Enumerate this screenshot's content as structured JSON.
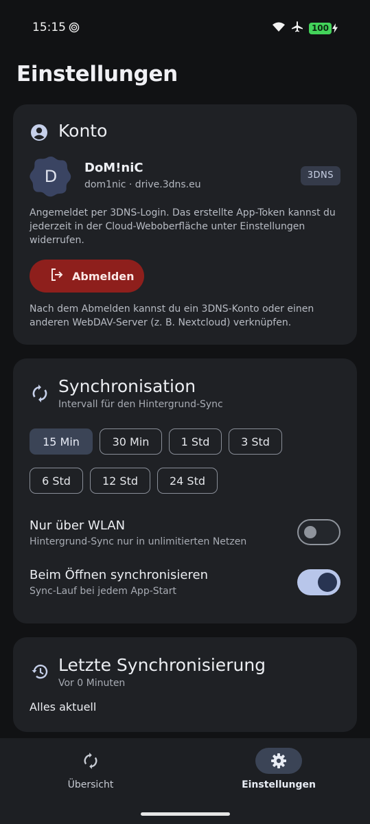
{
  "status_bar": {
    "time": "15:15",
    "battery": "100"
  },
  "page_title": "Einstellungen",
  "konto": {
    "title": "Konto",
    "avatar_letter": "D",
    "user_name": "DoM!niC",
    "user_sub": "dom1nic · drive.3dns.eu",
    "badge": "3DNS",
    "info": "Angemeldet per 3DNS-Login. Das erstellte App-Token kannst du jederzeit in der Cloud-Weboberfläche unter Einstellungen widerrufen.",
    "logout_label": "Abmelden",
    "note": "Nach dem Abmelden kannst du ein 3DNS-Konto oder einen anderen WebDAV-Server (z. B. Nextcloud) verknüpfen."
  },
  "sync": {
    "title": "Synchronisation",
    "subtitle": "Intervall für den Hintergrund-Sync",
    "intervals": [
      "15 Min",
      "30 Min",
      "1 Std",
      "3 Std",
      "6 Std",
      "12 Std",
      "24 Std"
    ],
    "selected_interval": "15 Min",
    "wlan_title": "Nur über WLAN",
    "wlan_sub": "Hintergrund-Sync nur in unlimitierten Netzen",
    "wlan_enabled": false,
    "open_title": "Beim Öffnen synchronisieren",
    "open_sub": "Sync-Lauf bei jedem App-Start",
    "open_enabled": true
  },
  "last_sync": {
    "title": "Letzte Synchronisierung",
    "subtitle": "Vor 0 Minuten",
    "status": "Alles aktuell"
  },
  "nav": {
    "overview_label": "Übersicht",
    "settings_label": "Einstellungen"
  },
  "colors": {
    "background": "#111214",
    "card": "#1f2125",
    "accent": "#3b4456",
    "danger": "#8e1f1c",
    "toggle_on": "#b8c6ea",
    "battery": "#43d35a"
  }
}
